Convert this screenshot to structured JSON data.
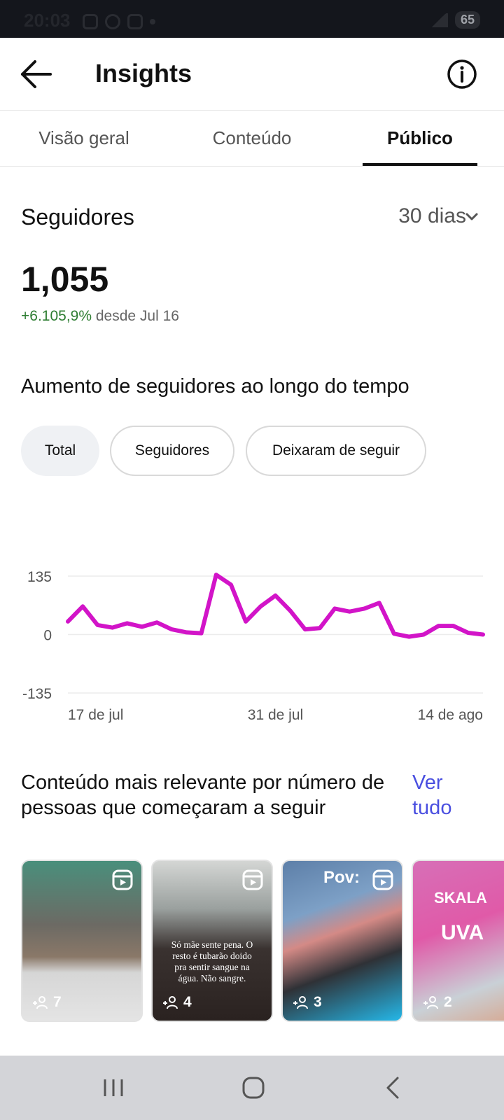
{
  "status_bar": {
    "time": "20:03",
    "battery": "65",
    "icons": [
      "notification-icon",
      "whatsapp-icon",
      "instagram-icon",
      "mute-icon",
      "wifi-icon",
      "signal-icon"
    ]
  },
  "header": {
    "title": "Insights",
    "back_icon": "arrow-left-icon",
    "info_icon": "info-icon"
  },
  "tabs": [
    {
      "label": "Visão geral",
      "active": false
    },
    {
      "label": "Conteúdo",
      "active": false
    },
    {
      "label": "Público",
      "active": true
    }
  ],
  "followers": {
    "title": "Seguidores",
    "period": "30 dias",
    "count": "1,055",
    "change": "+6.105,9%",
    "since": "desde Jul 16"
  },
  "growth": {
    "title": "Aumento de seguidores ao longo do tempo",
    "filters": [
      {
        "label": "Total",
        "selected": true
      },
      {
        "label": "Seguidores",
        "selected": false
      },
      {
        "label": "Deixaram de seguir",
        "selected": false
      }
    ]
  },
  "chart_data": {
    "type": "line",
    "title": "",
    "xlabel": "",
    "ylabel": "",
    "ylim": [
      -135,
      135
    ],
    "y_ticks": [
      "135",
      "0",
      "-135"
    ],
    "x_tick_labels": [
      {
        "label": "17 de jul",
        "index": 0
      },
      {
        "label": "31 de jul",
        "index": 14
      },
      {
        "label": "14 de ago",
        "index": 28
      }
    ],
    "color": "#d214c8",
    "grid": true,
    "series": [
      {
        "values": [
          30,
          65,
          22,
          16,
          26,
          18,
          28,
          12,
          5,
          3,
          138,
          115,
          30,
          65,
          90,
          55,
          12,
          15,
          60,
          53,
          60,
          73,
          2,
          -5,
          0,
          20,
          20,
          4,
          0
        ]
      }
    ]
  },
  "relevant": {
    "title": "Conteúdo mais relevante por número de pessoas que começaram a seguir",
    "see_all": "Ver tudo",
    "items": [
      {
        "count": "7",
        "caption": "",
        "overlay": ""
      },
      {
        "count": "4",
        "caption": "Só mãe sente pena. O resto é tubarão doido pra sentir sangue na água. Não sangre.",
        "overlay": ""
      },
      {
        "count": "3",
        "caption": "",
        "overlay": "Pov:"
      },
      {
        "count": "2",
        "caption": "",
        "overlay": "SKALA",
        "overlay2": "UVA"
      }
    ]
  },
  "nav": {
    "recent_icon": "recent-apps-icon",
    "home_icon": "home-icon",
    "back_icon": "back-icon"
  }
}
